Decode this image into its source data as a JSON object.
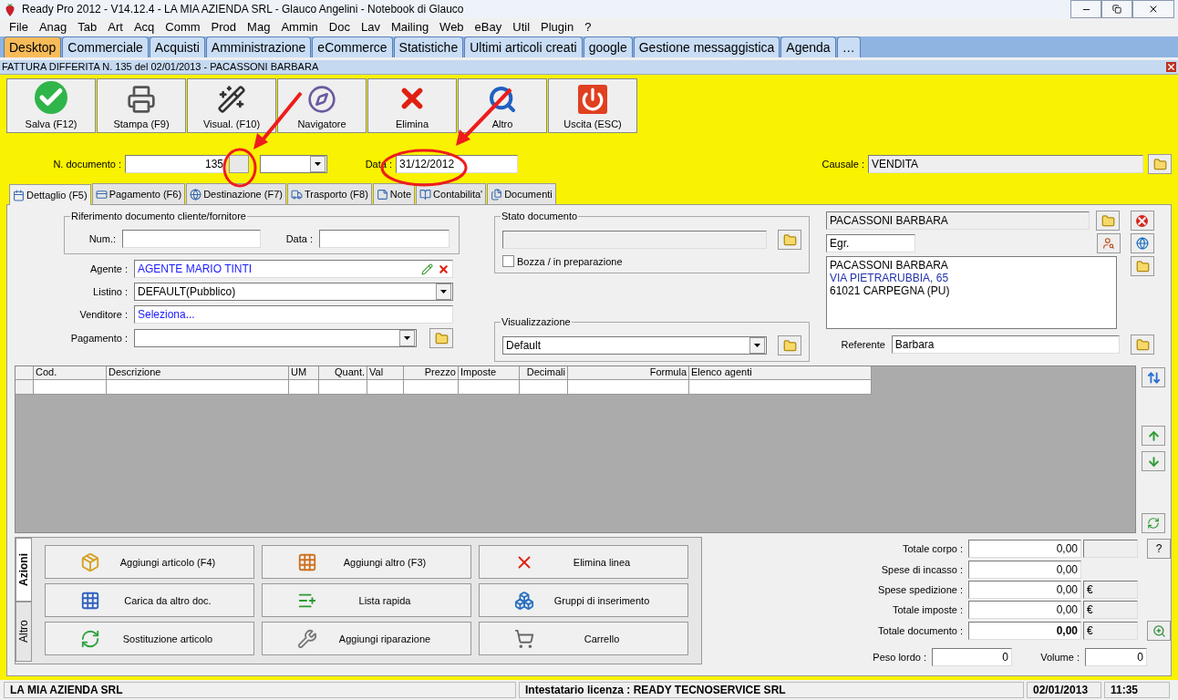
{
  "window": {
    "title": "Ready Pro 2012 - V14.12.4 - LA MIA AZIENDA SRL - Glauco Angelini - Notebook di Glauco"
  },
  "menu": [
    "File",
    "Anag",
    "Tab",
    "Art",
    "Acq",
    "Comm",
    "Prod",
    "Mag",
    "Ammin",
    "Doc",
    "Lav",
    "Mailing",
    "Web",
    "eBay",
    "Util",
    "Plugin",
    "?"
  ],
  "app_tabs": [
    {
      "label": "Desktop",
      "selected": true
    },
    {
      "label": "Commerciale",
      "selected": false
    },
    {
      "label": "Acquisti",
      "selected": false
    },
    {
      "label": "Amministrazione",
      "selected": false
    },
    {
      "label": "eCommerce",
      "selected": false
    },
    {
      "label": "Statistiche",
      "selected": false
    },
    {
      "label": "Ultimi articoli creati",
      "selected": false
    },
    {
      "label": "google",
      "selected": false
    },
    {
      "label": "Gestione messaggistica",
      "selected": false
    },
    {
      "label": "Agenda",
      "selected": false
    },
    {
      "label": "…",
      "selected": false
    }
  ],
  "document": {
    "title": "FATTURA DIFFERITA N. 135  del 02/01/2013 - PACASSONI BARBARA"
  },
  "toolbar": [
    "Salva (F12)",
    "Stampa (F9)",
    "Visual. (F10)",
    "Navigatore",
    "Elimina",
    "Altro",
    "Uscita (ESC)"
  ],
  "header": {
    "number_label": "N. documento :",
    "number": "135",
    "date_label": "Data :",
    "date": "31/12/2012",
    "causale_label": "Causale :",
    "causale": "VENDITA"
  },
  "doc_tabs": [
    {
      "label": "Dettaglio (F5)",
      "selected": true
    },
    {
      "label": "Pagamento (F6)",
      "selected": false
    },
    {
      "label": "Destinazione (F7)",
      "selected": false
    },
    {
      "label": "Trasporto (F8)",
      "selected": false
    },
    {
      "label": "Note",
      "selected": false
    },
    {
      "label": "Contabilita'",
      "selected": false
    },
    {
      "label": "Documenti",
      "selected": false
    }
  ],
  "riferimento": {
    "legend": "Riferimento documento cliente/fornitore",
    "num_label": "Num.:",
    "data_label": "Data :"
  },
  "fields": [
    {
      "kind": "agent",
      "label": "Agente :",
      "value": "AGENTE MARIO TINTI"
    },
    {
      "kind": "combo",
      "label": "Listino :",
      "value": "DEFAULT(Pubblico)"
    },
    {
      "kind": "link",
      "label": "Venditore :",
      "value": "Seleziona..."
    },
    {
      "kind": "combo-folder",
      "label": "Pagamento :"
    }
  ],
  "stato": {
    "legend": "Stato documento",
    "draft_label": "Bozza / in preparazione",
    "draft_checked": false
  },
  "visualizzazione": {
    "legend": "Visualizzazione",
    "value": "Default"
  },
  "customer": {
    "name": "PACASSONI BARBARA",
    "salutation": "Egr.",
    "address": [
      "PACASSONI BARBARA",
      "VIA PIETRARUBBIA, 65",
      "61021 CARPEGNA (PU)"
    ],
    "referente_label": "Referente",
    "referente": "Barbara"
  },
  "table": {
    "columns": [
      "Cod.",
      "Descrizione",
      "UM",
      "Quant.",
      "Val",
      "Prezzo",
      "Imposte",
      "Decimali",
      "Formula",
      "Elenco agenti"
    ]
  },
  "actions": {
    "side_tabs": [
      {
        "label": "Azioni",
        "selected": true
      },
      {
        "label": "Altro",
        "selected": false
      }
    ],
    "buttons": [
      "Aggiungi articolo (F4)",
      "Aggiungi altro (F3)",
      "Elimina linea",
      "Carica da altro doc.",
      "Lista rapida",
      "Gruppi di inserimento",
      "Sostituzione articolo",
      "Aggiungi riparazione",
      "Carrello"
    ]
  },
  "totals": {
    "rows": [
      {
        "kind": "help",
        "label": "Totale corpo :",
        "value": "0,00",
        "help": "?"
      },
      {
        "kind": "plain",
        "label": "Spese di incasso :",
        "value": "0,00"
      },
      {
        "kind": "currency",
        "label": "Spese spedizione :",
        "value": "0,00",
        "unit": "€"
      },
      {
        "kind": "currency",
        "label": "Totale imposte :",
        "value": "0,00",
        "unit": "€"
      },
      {
        "kind": "total",
        "label": "Totale documento :",
        "value": "0,00",
        "unit": "€"
      }
    ],
    "weight_label": "Peso lordo :",
    "weight": "0",
    "volume_label": "Volume :",
    "volume": "0"
  },
  "status_bar": {
    "company": "LA MIA AZIENDA SRL",
    "license": "Intestatario licenza : READY TECNOSERVICE SRL",
    "date": "02/01/2013",
    "time": "11:35"
  }
}
